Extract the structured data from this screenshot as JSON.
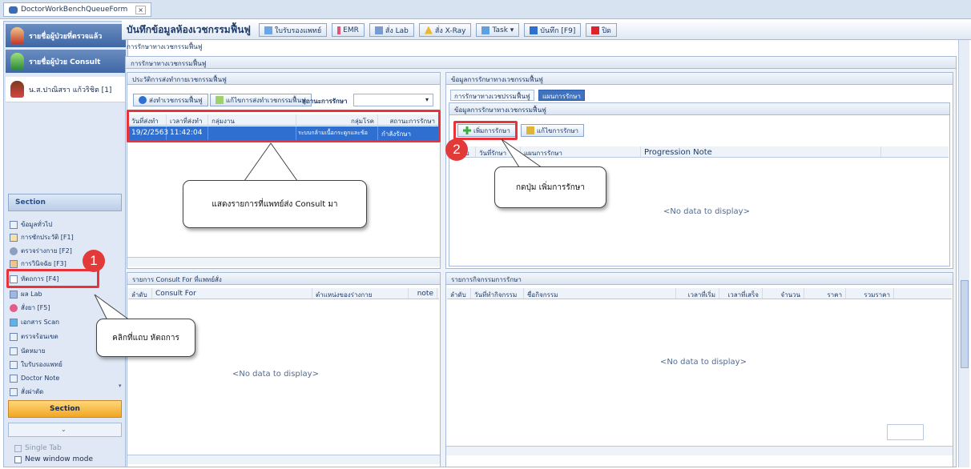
{
  "window_tab": {
    "title": "DoctorWorkBenchQueueForm",
    "close": "×"
  },
  "sidebar": {
    "patients": [
      {
        "label": "รายชื่อผู้ป่วยที่ตรวจแล้ว"
      },
      {
        "label": "รายชื่อผู้ป่วย Consult"
      },
      {
        "label": "น.ส.ปาณิสรา แก้วริชิต [1]"
      }
    ],
    "section_header": "Section",
    "items": [
      {
        "label": "ข้อมูลทั่วไป"
      },
      {
        "label": "การซักประวัติ [F1]"
      },
      {
        "label": "ตรวจร่างกาย [F2]"
      },
      {
        "label": "การวินิจฉัย [F3]"
      },
      {
        "label": "หัตถการ [F4]"
      },
      {
        "label": "ผล Lab"
      },
      {
        "label": "สั่งยา [F5]"
      },
      {
        "label": "เอกสาร Scan"
      },
      {
        "label": "ตรวจร้อนเขต"
      },
      {
        "label": "นัดหมาย"
      },
      {
        "label": "ใบรับรองแพทย์"
      },
      {
        "label": "Doctor Note"
      },
      {
        "label": "สั่งผ่าตัด"
      }
    ],
    "section_footer": "Section",
    "single_tab": "Single Tab",
    "new_window_mode": "New window mode"
  },
  "toolbar": {
    "title": "บันทึกข้อมูลห้องเวชกรรมฟื้นฟู",
    "buttons": [
      {
        "label": "ใบรับรองแพทย์"
      },
      {
        "label": "EMR"
      },
      {
        "label": "สั่ง Lab"
      },
      {
        "label": "สั่ง X-Ray"
      },
      {
        "label": "Task ▾"
      },
      {
        "label": "บันทึก [F9]"
      },
      {
        "label": "ปิด"
      }
    ]
  },
  "subtitle": "การรักษาทางเวชกรรมฟื้นฟู",
  "group_title": "การรักษาทางเวชกรรมฟื้นฟู",
  "left_panel": {
    "title": "ประวัติการส่งทำกายเวชกรรมฟื้นฟู",
    "btn_send": "ส่งทำเวชกรรมฟื้นฟู",
    "btn_edit": "แก้ไขการส่งทำเวชกรรมฟื้นฟู",
    "status_label": "สถานะการรักษา",
    "columns": [
      "วันที่ส่งทำ",
      "เวลาที่ส่งทำ",
      "กลุ่มงาน",
      "กลุ่มโรค",
      "สถานะการรักษา"
    ],
    "rows": [
      [
        "19/2/2563",
        "11:42:04",
        "",
        "ระบบกล้ามเนื้อกระดูกและข้อ",
        "กำลังรักษา"
      ]
    ]
  },
  "consult_panel": {
    "title": "รายการ Consult For ที่แพทย์สั่ง",
    "columns": [
      "ลำดับ",
      "Consult For",
      "ตำแหน่งของร่างกาย",
      "note"
    ],
    "empty": "<No data to display>"
  },
  "right_panel": {
    "title": "ข้อมูลการรักษาทางเวชกรรมฟื้นฟู",
    "tabs": [
      "การรักษาทางเวชปรรมฟื้นฟู",
      "แผนการรักษา"
    ],
    "inner_title": "ข้อมูลการรักษาทางเวชกรรมฟื้นฟู",
    "btn_add": "เพิ่มการรักษา",
    "btn_edit": "แก้ไขการรักษา",
    "columns": [
      "ลำดับ",
      "วันที่รักษา",
      "แผนการรักษา",
      "Progression Note"
    ],
    "empty": "<No data to display>"
  },
  "activity_panel": {
    "title": "รายการกิจกรรมการรักษา",
    "columns": [
      "ลำดับ",
      "วันที่ทำกิจกรรม",
      "ชื่อกิจกรรม",
      "เวลาที่เริ่ม",
      "เวลาที่เสร็จ",
      "จำนวน",
      "ราคา",
      "รวมราคา"
    ],
    "empty": "<No data to display>"
  },
  "annotations": {
    "step1": "1",
    "step2": "2",
    "callout_list": "แสดงรายการที่แพทย์ส่ง Consult มา",
    "callout_add": "กดปุ่ม เพิ่มการรักษา",
    "callout_tab": "คลิกที่แถบ หัตถการ"
  },
  "colors": {
    "accent_red": "#e8333a",
    "selected_row": "#2f6fd0"
  }
}
